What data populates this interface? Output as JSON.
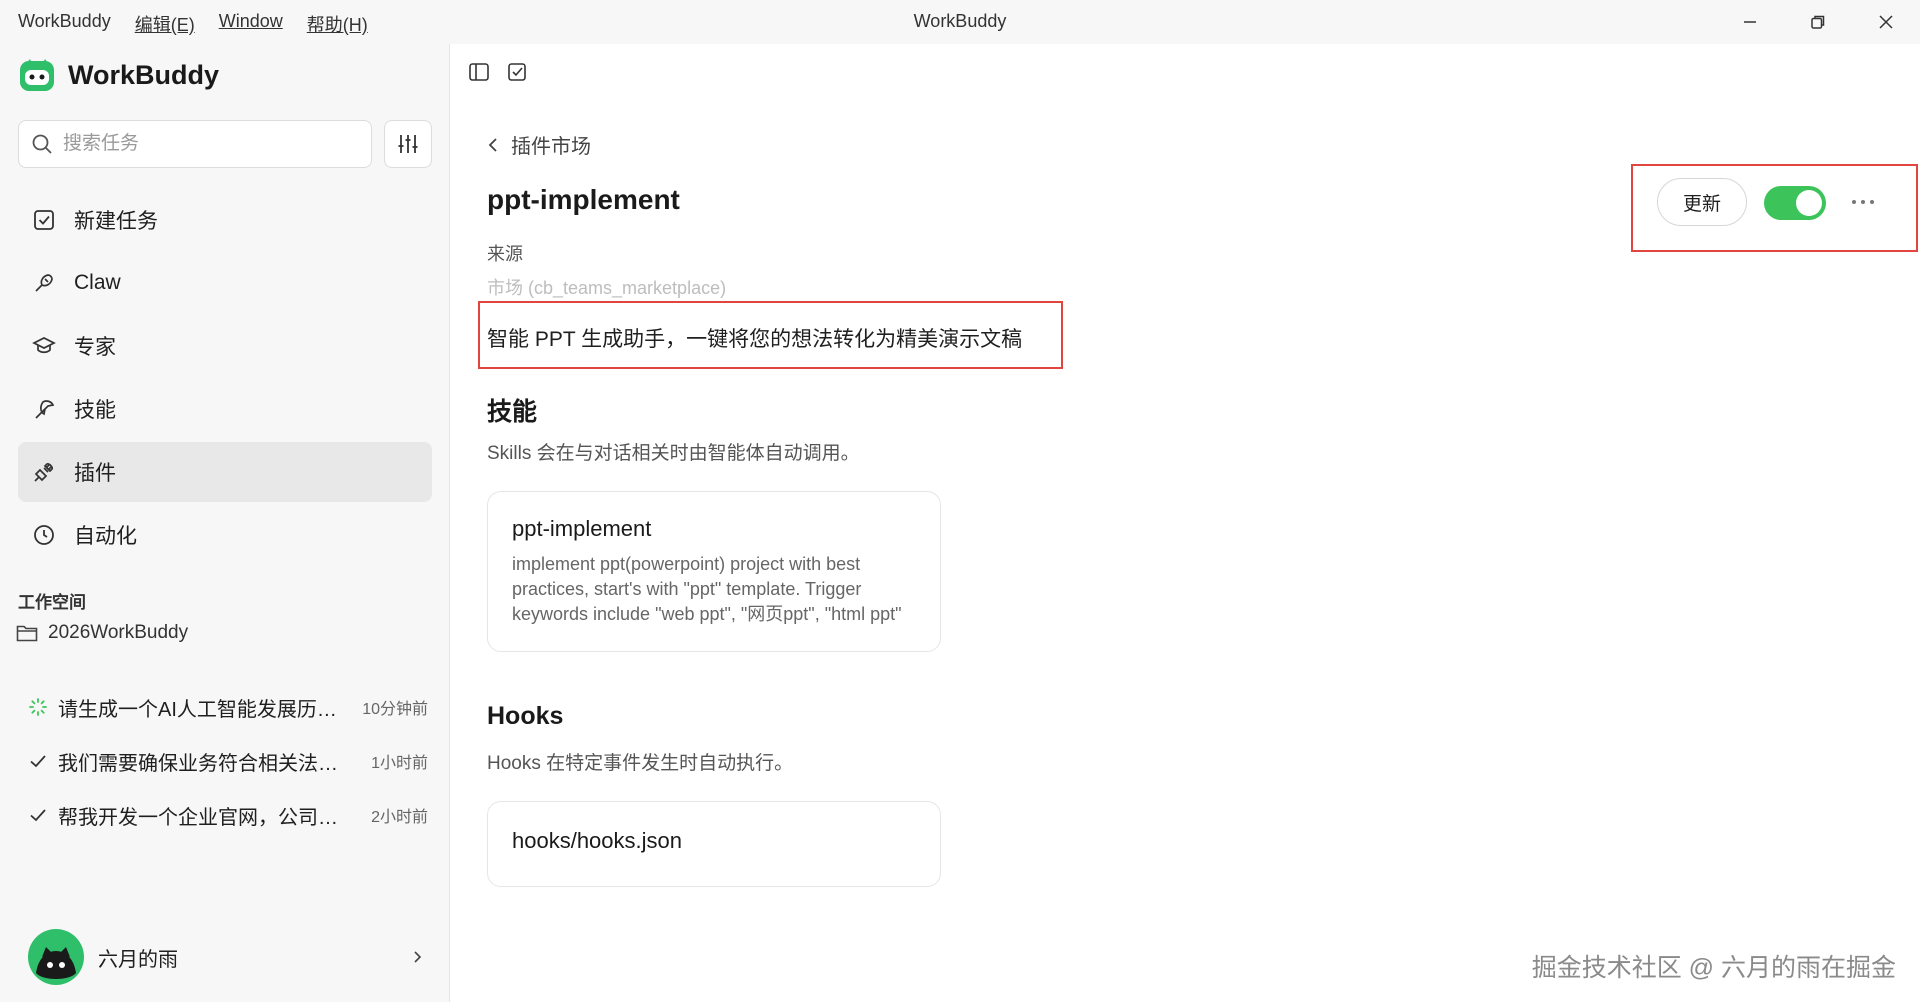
{
  "window": {
    "title": "WorkBuddy",
    "menu": [
      {
        "label": "WorkBuddy",
        "mnemonic": false
      },
      {
        "label": "编辑(E)",
        "mnemonic": true
      },
      {
        "label": "Window",
        "mnemonic": true
      },
      {
        "label": "帮助(H)",
        "mnemonic": true
      }
    ]
  },
  "sidebar": {
    "brand": "WorkBuddy",
    "search_placeholder": "搜索任务",
    "nav": [
      {
        "label": "新建任务",
        "icon": "new-task-icon",
        "active": false
      },
      {
        "label": "Claw",
        "icon": "claw-icon",
        "active": false
      },
      {
        "label": "专家",
        "icon": "expert-icon",
        "active": false
      },
      {
        "label": "技能",
        "icon": "skill-icon",
        "active": false
      },
      {
        "label": "插件",
        "icon": "plugin-icon",
        "active": true
      },
      {
        "label": "自动化",
        "icon": "clock-icon",
        "active": false
      }
    ],
    "workspace_label": "工作空间",
    "folder": "2026WorkBuddy",
    "tasks": [
      {
        "title": "请生成一个AI人工智能发展历史介绍的PPT",
        "time": "10分钟前",
        "status": "running"
      },
      {
        "title": "我们需要确保业务符合相关法律法规",
        "time": "1小时前",
        "status": "done"
      },
      {
        "title": "帮我开发一个企业官网，公司名称为",
        "time": "2小时前",
        "status": "done"
      }
    ],
    "user": {
      "name": "六月的雨"
    }
  },
  "main": {
    "back_label": "插件市场",
    "plugin": {
      "name": "ppt-implement",
      "source_label": "来源",
      "source_value": "市场 (cb_teams_marketplace)",
      "description": "智能 PPT 生成助手，一键将您的想法转化为精美演示文稿",
      "enabled": true
    },
    "update_label": "更新",
    "skills": {
      "heading": "技能",
      "subtitle": "Skills 会在与对话相关时由智能体自动调用。",
      "items": [
        {
          "title": "ppt-implement",
          "description": "implement ppt(powerpoint) project with best practices, start's with \"ppt\" template. Trigger keywords include \"web ppt\", \"网页ppt\", \"html ppt\""
        }
      ]
    },
    "hooks": {
      "heading": "Hooks",
      "subtitle": "Hooks 在特定事件发生时自动执行。",
      "items": [
        {
          "title": "hooks/hooks.json"
        }
      ]
    }
  },
  "watermark": "掘金技术社区 @ 六月的雨在掘金",
  "colors": {
    "accent_green": "#3cc45a",
    "highlight_red": "#e0463e",
    "sidebar_bg": "#f7f7f7"
  }
}
